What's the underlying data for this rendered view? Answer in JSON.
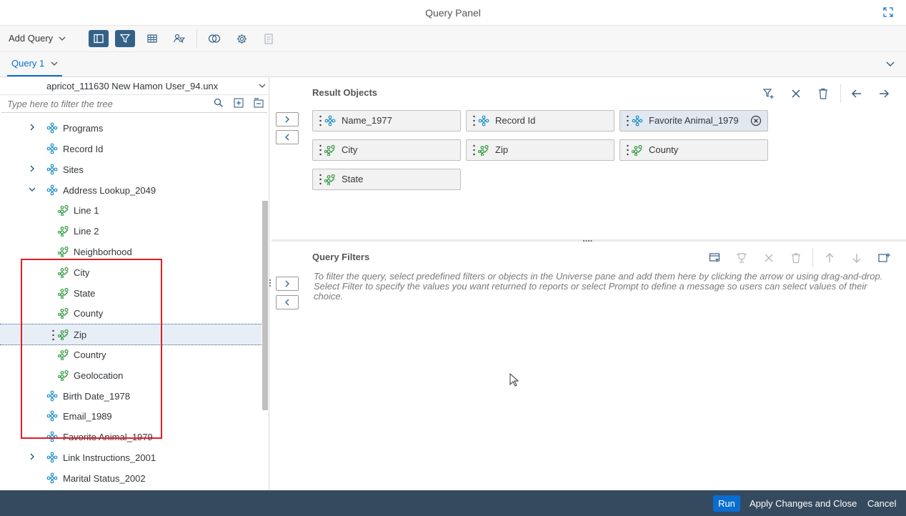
{
  "window": {
    "title": "Query Panel"
  },
  "toolbar": {
    "add_query_label": "Add Query"
  },
  "tabs": [
    {
      "label": "Query 1"
    }
  ],
  "universe": {
    "name": "apricot_111630 New Hamon User_94.unx"
  },
  "tree_filter": {
    "placeholder": "Type here to filter the tree"
  },
  "tree": [
    {
      "label": "Programs",
      "type": "folder",
      "expandable": true
    },
    {
      "label": "Record Id",
      "type": "dimension"
    },
    {
      "label": "Sites",
      "type": "folder",
      "expandable": true
    },
    {
      "label": "Address Lookup_2049",
      "type": "folder",
      "expanded": true
    },
    {
      "label": "Line 1",
      "type": "detail"
    },
    {
      "label": "Line 2",
      "type": "detail"
    },
    {
      "label": "Neighborhood",
      "type": "detail"
    },
    {
      "label": "City",
      "type": "detail"
    },
    {
      "label": "State",
      "type": "detail"
    },
    {
      "label": "County",
      "type": "detail"
    },
    {
      "label": "Zip",
      "type": "detail",
      "selected": true
    },
    {
      "label": "Country",
      "type": "detail"
    },
    {
      "label": "Geolocation",
      "type": "detail"
    },
    {
      "label": "Birth Date_1978",
      "type": "dimension"
    },
    {
      "label": "Email_1989",
      "type": "dimension"
    },
    {
      "label": "Favorite Animal_1979",
      "type": "dimension"
    },
    {
      "label": "Link Instructions_2001",
      "type": "folder",
      "expandable": true
    },
    {
      "label": "Marital Status_2002",
      "type": "dimension"
    }
  ],
  "result_objects": {
    "title": "Result Objects",
    "items": [
      {
        "label": "Name_1977",
        "type": "dimension"
      },
      {
        "label": "Record Id",
        "type": "dimension"
      },
      {
        "label": "Favorite Animal_1979",
        "type": "dimension",
        "selected": true
      },
      {
        "label": "City",
        "type": "detail"
      },
      {
        "label": "Zip",
        "type": "detail"
      },
      {
        "label": "County",
        "type": "detail"
      },
      {
        "label": "State",
        "type": "detail"
      }
    ]
  },
  "query_filters": {
    "title": "Query Filters",
    "message": "To filter the query, select predefined filters or objects in the Universe pane and add them here by clicking the arrow or using drag-and-drop. Select Filter to specify the values you want returned to reports or select Prompt to define a message so users can select values of their choice."
  },
  "footer": {
    "run": "Run",
    "apply": "Apply Changes and Close",
    "cancel": "Cancel"
  },
  "colors": {
    "accent": "#0a6ed1",
    "footer_bg": "#354a5f",
    "toggle_active": "#346187",
    "highlight": "#e01e26"
  }
}
